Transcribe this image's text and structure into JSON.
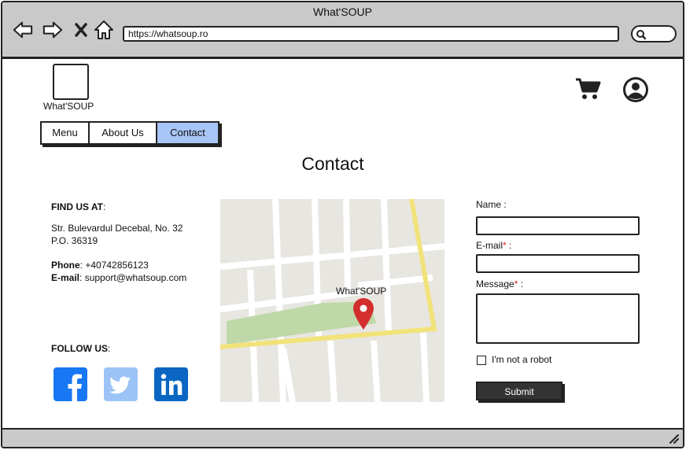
{
  "browser": {
    "title": "What'SOUP",
    "url": "https://whatsoup.ro",
    "icons": [
      "back-icon",
      "forward-icon",
      "close-icon",
      "home-icon",
      "search-icon"
    ]
  },
  "header": {
    "logo_text": "What'SOUP",
    "icons": [
      "cart-icon",
      "user-icon"
    ]
  },
  "nav": {
    "tabs": [
      {
        "label": "Menu",
        "active": false
      },
      {
        "label": "About Us",
        "active": false
      },
      {
        "label": "Contact",
        "active": true
      }
    ],
    "active_color": "#a7c5f6"
  },
  "page": {
    "title": "Contact"
  },
  "find_us": {
    "heading": "FIND US AT",
    "address_line1": "Str. Bulevardul Decebal, No. 32",
    "address_line2": "P.O. 36319",
    "phone_label": "Phone",
    "phone": "+40742856123",
    "email_label": "E-mail",
    "email": "support@whatsoup.com"
  },
  "follow_us": {
    "heading": "FOLLOW US",
    "networks": [
      {
        "name": "facebook-icon",
        "color": "#1877f2"
      },
      {
        "name": "twitter-icon",
        "color": "#9cc3f5"
      },
      {
        "name": "linkedin-icon",
        "color": "#0a66c2"
      }
    ]
  },
  "map": {
    "marker_label": "What'SOUP",
    "marker_color": "#d32f2f",
    "road_color": "#f2e27a",
    "park_color": "#bfd8a8"
  },
  "form": {
    "name_label": "Name",
    "name_value": "",
    "email_label": "E-mail",
    "email_value": "",
    "message_label": "Message",
    "message_value": "",
    "required_mark": "*",
    "captcha_label": "I'm not a robot",
    "captcha_checked": false,
    "submit_label": "Submit"
  }
}
